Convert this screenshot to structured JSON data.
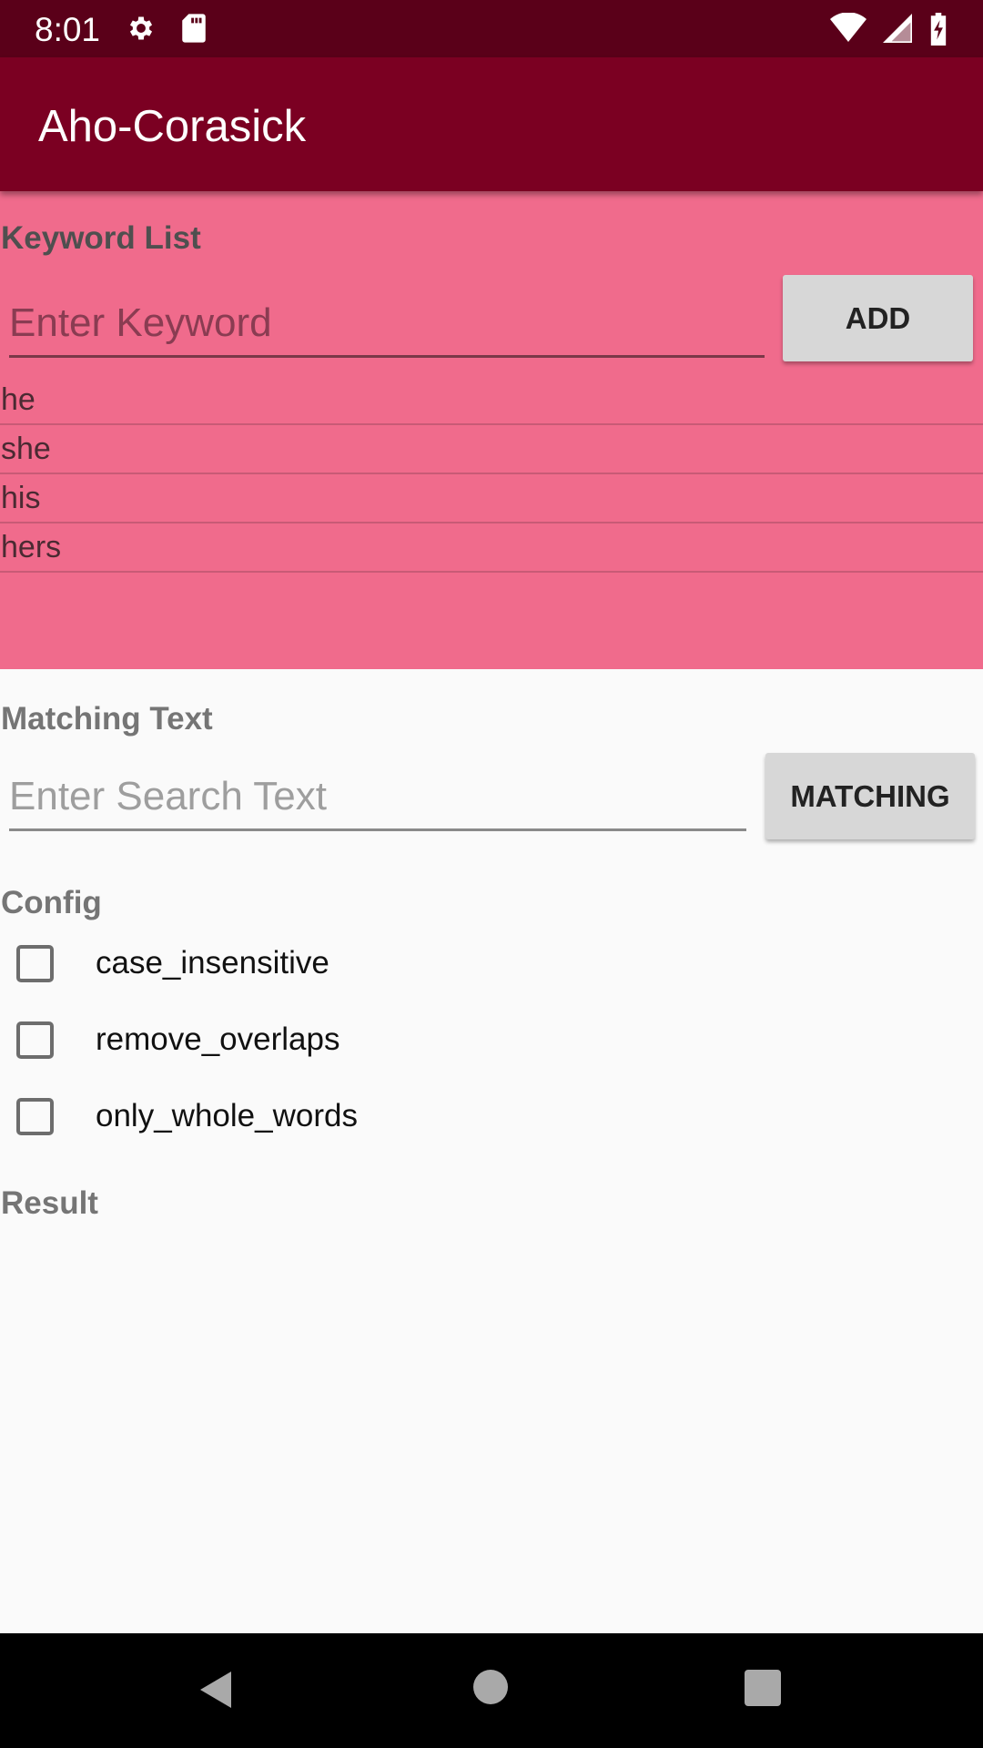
{
  "status_bar": {
    "time": "8:01",
    "left_icons": [
      "settings-icon",
      "sd-card-icon"
    ],
    "right_icons": [
      "wifi-icon",
      "signal-icon",
      "battery-charging-icon"
    ]
  },
  "app_bar": {
    "title": "Aho-Corasick",
    "color": "#7b0022"
  },
  "keyword_section": {
    "label": "Keyword List",
    "input_placeholder": "Enter Keyword",
    "input_value": "",
    "add_button": "ADD",
    "keywords": [
      "he",
      "she",
      "his",
      "hers"
    ],
    "background_color": "#f06b8c"
  },
  "matching_section": {
    "label": "Matching Text",
    "input_placeholder": "Enter Search Text",
    "input_value": "",
    "button": "MATCHING"
  },
  "config_section": {
    "label": "Config",
    "options": [
      {
        "label": "case_insensitive",
        "checked": false
      },
      {
        "label": "remove_overlaps",
        "checked": false
      },
      {
        "label": "only_whole_words",
        "checked": false
      }
    ]
  },
  "result_section": {
    "label": "Result"
  },
  "nav_bar": {
    "icons": [
      "back-icon",
      "home-icon",
      "recents-icon"
    ]
  }
}
